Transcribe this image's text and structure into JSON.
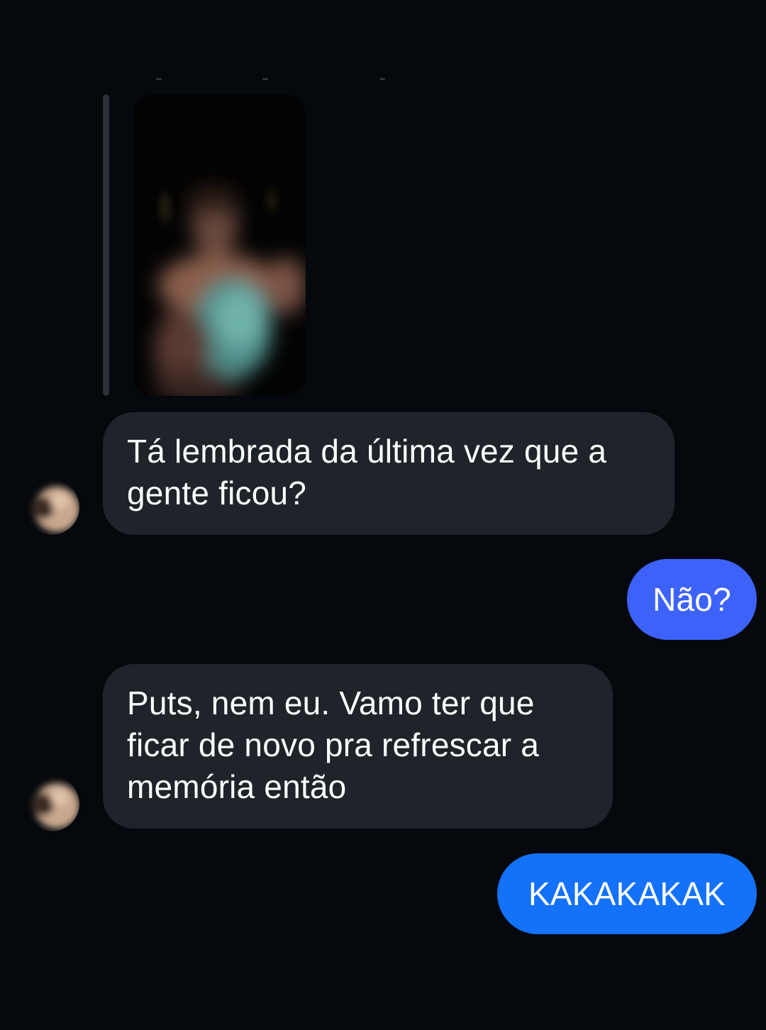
{
  "conversation": {
    "messages": [
      {
        "direction": "incoming",
        "text": "Tá lembrada da última vez que a\ngente ficou?"
      },
      {
        "direction": "outgoing",
        "text": "Não?"
      },
      {
        "direction": "incoming",
        "text": "Puts, nem eu. Vamo ter que\nficar de novo pra refrescar a\nmemória então"
      },
      {
        "direction": "outgoing",
        "text": "KAKAKAKAK"
      }
    ],
    "reply_preview": {
      "icon": "blurred-photo-thumbnail"
    },
    "avatar_icon": "contact-avatar-icon"
  },
  "colors": {
    "background": "#05080c",
    "incoming_bubble": "#1f242b",
    "outgoing_bubble_1": "#3d62fa",
    "outgoing_bubble_2": "#1471f9",
    "text": "#ffffff"
  }
}
